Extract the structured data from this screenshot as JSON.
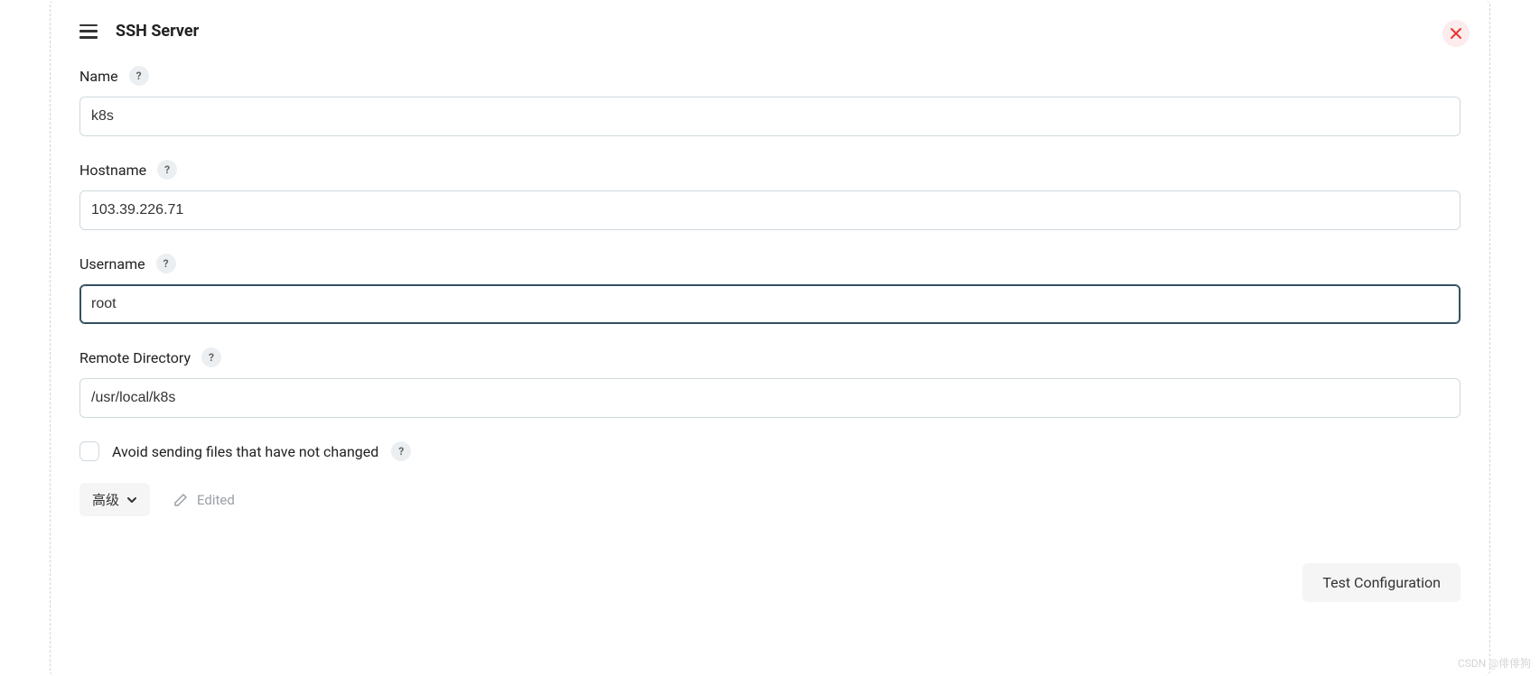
{
  "title": "SSH Server",
  "fields": {
    "name": {
      "label": "Name",
      "value": "k8s"
    },
    "hostname": {
      "label": "Hostname",
      "value": "103.39.226.71"
    },
    "username": {
      "label": "Username",
      "value": "root"
    },
    "remote_directory": {
      "label": "Remote Directory",
      "value": "/usr/local/k8s"
    }
  },
  "checkbox": {
    "avoid_unchanged": {
      "label": "Avoid sending files that have not changed",
      "checked": false
    }
  },
  "toolbar": {
    "advanced_label": "高级",
    "edited_label": "Edited"
  },
  "footer": {
    "test_config_label": "Test Configuration"
  },
  "help_symbol": "?",
  "watermark": "CSDN @俳俳狗"
}
